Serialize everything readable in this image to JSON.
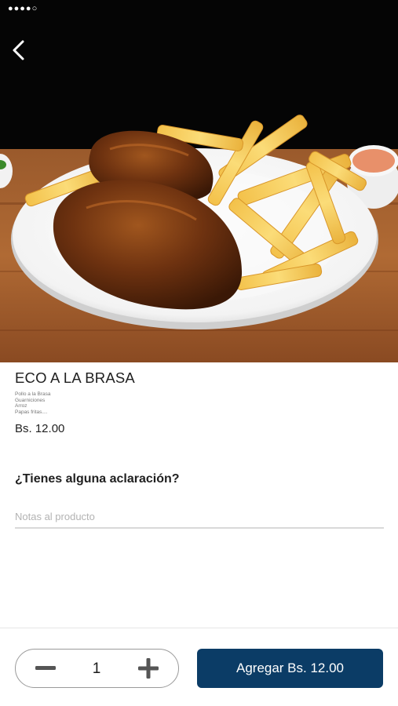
{
  "status_bar": {
    "left": "●●●●○ ︎",
    "time": "",
    "right": ""
  },
  "product": {
    "name": "ECO A LA BRASA",
    "description_lines": [
      "Pollo a la Brasa",
      "Guarniciones",
      "Arroz",
      "Papas fritas...."
    ],
    "price": "Bs. 12.00",
    "image_icon": "product-photo"
  },
  "notes": {
    "question": "¿Tienes alguna aclaración?",
    "placeholder": "Notas al producto",
    "value": ""
  },
  "cart": {
    "quantity": "1",
    "minus_icon": "minus-icon",
    "plus_icon": "plus-icon",
    "add_label": "Agregar Bs. 12.00"
  },
  "colors": {
    "primary": "#0b3c66",
    "divider": "#d9d9d9",
    "hero_bg": "#050505"
  },
  "icons": {
    "back": "chevron-left-icon"
  }
}
